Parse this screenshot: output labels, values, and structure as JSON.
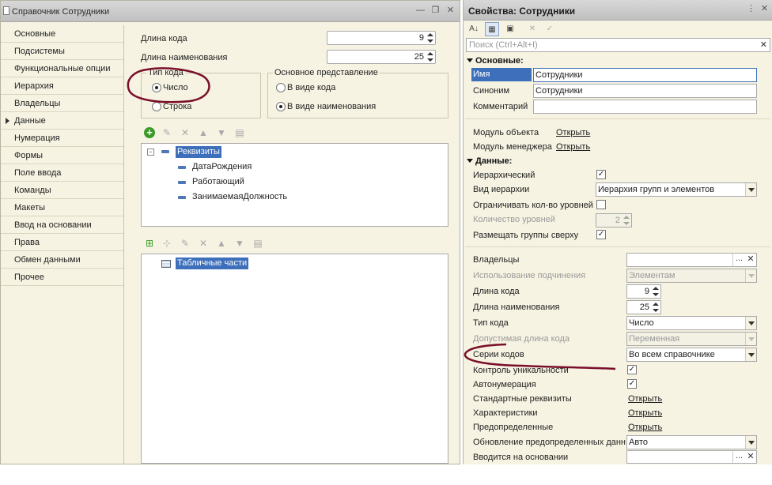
{
  "left_window": {
    "title": "Справочник Сотрудники",
    "nav_items": [
      {
        "label": "Основные"
      },
      {
        "label": "Подсистемы"
      },
      {
        "label": "Функциональные опции"
      },
      {
        "label": "Иерархия"
      },
      {
        "label": "Владельцы"
      },
      {
        "label": "Данные",
        "active": true
      },
      {
        "label": "Нумерация"
      },
      {
        "label": "Формы"
      },
      {
        "label": "Поле ввода"
      },
      {
        "label": "Команды"
      },
      {
        "label": "Макеты"
      },
      {
        "label": "Ввод на основании"
      },
      {
        "label": "Права"
      },
      {
        "label": "Обмен данными"
      },
      {
        "label": "Прочее"
      }
    ],
    "code_length_label": "Длина кода",
    "code_length_value": "9",
    "name_length_label": "Длина наименования",
    "name_length_value": "25",
    "code_type": {
      "title": "Тип кода",
      "options": [
        "Число",
        "Строка"
      ],
      "selected": "Число"
    },
    "main_presentation": {
      "title": "Основное представление",
      "options": [
        "В виде кода",
        "В виде наименования"
      ],
      "selected": "В виде наименования"
    },
    "attributes_tree": {
      "root": "Реквизиты",
      "items": [
        "ДатаРождения",
        "Работающий",
        "ЗанимаемаяДолжность"
      ]
    },
    "tabular_tree": {
      "root": "Табличные части"
    }
  },
  "right_window": {
    "title": "Свойства: Сотрудники",
    "search_placeholder": "Поиск (Ctrl+Alt+I)",
    "sections": {
      "main": "Основные:",
      "data": "Данные:"
    },
    "main": {
      "name_label": "Имя",
      "name_value": "Сотрудники",
      "synonym_label": "Синоним",
      "synonym_value": "Сотрудники",
      "comment_label": "Комментарий",
      "comment_value": "",
      "object_module_label": "Модуль объекта",
      "object_module_link": "Открыть",
      "manager_module_label": "Модуль менеджера",
      "manager_module_link": "Открыть"
    },
    "data": {
      "hierarchical_label": "Иерархический",
      "hierarchical_checked": true,
      "hierarchy_kind_label": "Вид иерархии",
      "hierarchy_kind_value": "Иерархия групп и элементов",
      "limit_levels_label": "Ограничивать кол-во уровней",
      "limit_levels_checked": false,
      "levels_count_label": "Количество уровней",
      "levels_count_value": "2",
      "groups_on_top_label": "Размещать группы сверху",
      "groups_on_top_checked": true,
      "owners_label": "Владельцы",
      "owners_value": "",
      "subordination_label": "Использование подчинения",
      "subordination_value": "Элементам",
      "code_length_label": "Длина кода",
      "code_length_value": "9",
      "name_length_label": "Длина наименования",
      "name_length_value": "25",
      "code_type_label": "Тип кода",
      "code_type_value": "Число",
      "allowed_code_length_label": "Допустимая длина кода",
      "allowed_code_length_value": "Переменная",
      "code_series_label": "Серии кодов",
      "code_series_value": "Во всем справочнике",
      "uniqueness_label": "Контроль уникальности",
      "uniqueness_checked": true,
      "autonumbering_label": "Автонумерация",
      "autonumbering_checked": true,
      "standard_attrs_label": "Стандартные реквизиты",
      "standard_attrs_link": "Открыть",
      "characteristics_label": "Характеристики",
      "characteristics_link": "Открыть",
      "predefined_label": "Предопределенные",
      "predefined_link": "Открыть",
      "predefined_update_label": "Обновление предопределенных данных",
      "predefined_update_value": "Авто",
      "based_on_label": "Вводится на основании",
      "based_on_value": ""
    }
  },
  "colors": {
    "panel_bg": "#f6f3e2",
    "selection": "#3d6fba",
    "annotation": "#7a0f2a"
  }
}
